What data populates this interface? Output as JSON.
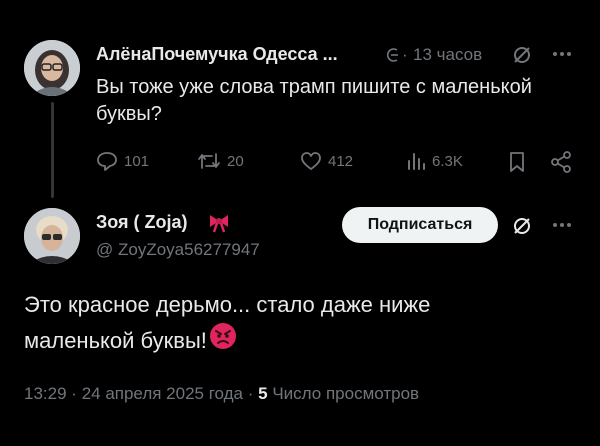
{
  "reply": {
    "author_name": "АлёнаПочемучка Одесса ...",
    "time_label": "13 часов",
    "separator": "·",
    "text": "Вы тоже уже слова трамп  пишите с маленькой буквы?",
    "actions": {
      "replies": "101",
      "reposts": "20",
      "likes": "412",
      "views": "6.3K"
    }
  },
  "main": {
    "author_name": "Зоя ( Zoja)",
    "handle": "@ ZoyZoya56277947",
    "follow_label": "Подписаться",
    "text_line1": "Это красное дерьмо... стало даже ниже",
    "text_line2": "маленькой буквы!",
    "time": "13:29",
    "date": "24 апреля 2025 года",
    "views_count": "5",
    "views_label": "Число просмотров",
    "dot": "·"
  },
  "icons": [
    "avatar-woman-glasses",
    "grok-icon",
    "x-slash-icon",
    "more-icon",
    "reply-icon",
    "repost-icon",
    "like-icon",
    "views-icon",
    "bookmark-icon",
    "share-icon",
    "bow-emoji",
    "angry-face-emoji"
  ],
  "colors": {
    "background": "#000000",
    "text": "#e7e9ea",
    "muted": "#71767b",
    "button_bg": "#eff3f4",
    "angry": "#e0245e"
  }
}
